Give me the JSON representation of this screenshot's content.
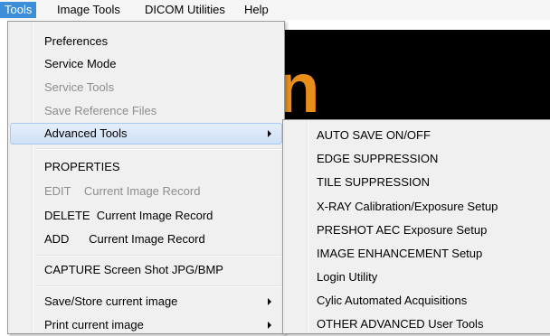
{
  "menubar": {
    "items": [
      "Tools",
      "Image Tools",
      "DICOM Utilities",
      "Help"
    ]
  },
  "background": {
    "brand_letter": "n",
    "brand_color": "#e88f1b"
  },
  "tools_menu": {
    "items": [
      {
        "label": "Preferences",
        "enabled": true
      },
      {
        "label": "Service Mode",
        "enabled": true
      },
      {
        "label": "Service Tools",
        "enabled": false
      },
      {
        "label": "Save Reference Files",
        "enabled": false
      },
      {
        "label": "Advanced Tools",
        "enabled": true,
        "submenu": true,
        "highlighted": true
      },
      {
        "label": "PROPERTIES",
        "enabled": true
      },
      {
        "label": "EDIT    Current Image Record",
        "enabled": false
      },
      {
        "label": "DELETE  Current Image Record",
        "enabled": true
      },
      {
        "label": "ADD      Current Image Record",
        "enabled": true
      },
      {
        "label": "CAPTURE Screen Shot JPG/BMP",
        "enabled": true
      },
      {
        "label": "Save/Store current image",
        "enabled": true,
        "submenu": true
      },
      {
        "label": "Print current image",
        "enabled": true,
        "submenu": true
      }
    ]
  },
  "advanced_tools_submenu": {
    "items": [
      "AUTO SAVE ON/OFF",
      "EDGE SUPPRESSION",
      "TILE SUPPRESSION",
      "X-RAY Calibration/Exposure Setup",
      "PRESHOT AEC Exposure Setup",
      "IMAGE ENHANCEMENT Setup",
      "Login Utility",
      "Cylic Automated Acquisitions",
      "OTHER ADVANCED User Tools"
    ]
  },
  "colors": {
    "menubar_active": "#3d8ed8",
    "menu_bg": "#f0f0f0",
    "highlight": "#cfe0f5"
  }
}
